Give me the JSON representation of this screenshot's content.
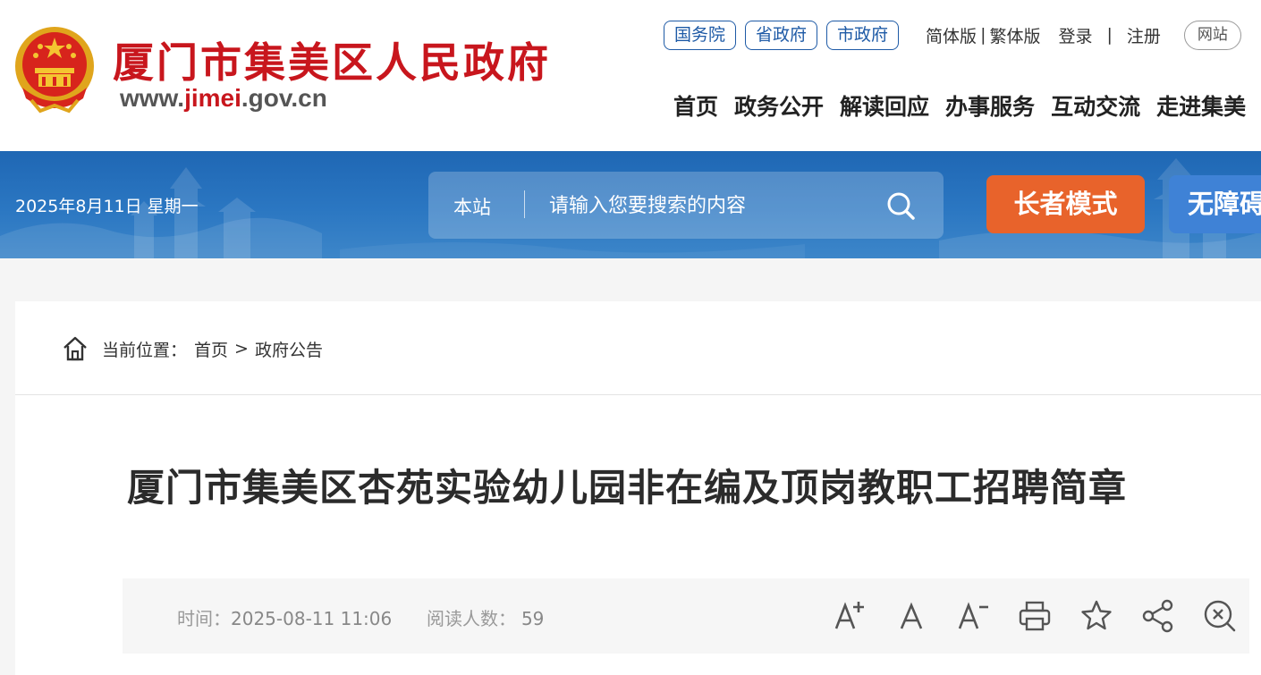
{
  "header": {
    "site_name": "厦门市集美区人民政府",
    "site_url_prefix": "www.",
    "site_url_highlight": "jimei",
    "site_url_suffix": ".gov.cn",
    "top_links": [
      "国务院",
      "省政府",
      "市政府"
    ],
    "lang_simplified": "简体版",
    "lang_sep": "|",
    "lang_traditional": "繁体版",
    "login": "登录",
    "login_sep": "|",
    "register": "注册",
    "partial_pill": "网站"
  },
  "nav": {
    "items": [
      "首页",
      "政务公开",
      "解读回应",
      "办事服务",
      "互动交流",
      "走进集美"
    ]
  },
  "banner": {
    "date": "2025年8月11日 星期一",
    "search_scope": "本站",
    "search_placeholder": "请输入您要搜索的内容",
    "elder_mode": "长者模式",
    "accessibility": "无障碍"
  },
  "breadcrumb": {
    "label": "当前位置：",
    "items": [
      "首页",
      "政府公告"
    ],
    "separator": ">"
  },
  "article": {
    "title": "厦门市集美区杏苑实验幼儿园非在编及顶岗教职工招聘简章",
    "time_label": "时间：",
    "time": "2025-08-11 11:06",
    "reads_label": "阅读人数：",
    "reads": "59"
  },
  "tools": [
    "font-increase-icon",
    "font-normal-icon",
    "font-decrease-icon",
    "print-icon",
    "favorite-star-icon",
    "share-icon",
    "close-zoom-icon"
  ],
  "colors": {
    "brand_red": "#c8161d",
    "brand_blue": "#1e5aa6",
    "banner_blue": "#2b77c2",
    "elder_orange": "#e8632b"
  }
}
